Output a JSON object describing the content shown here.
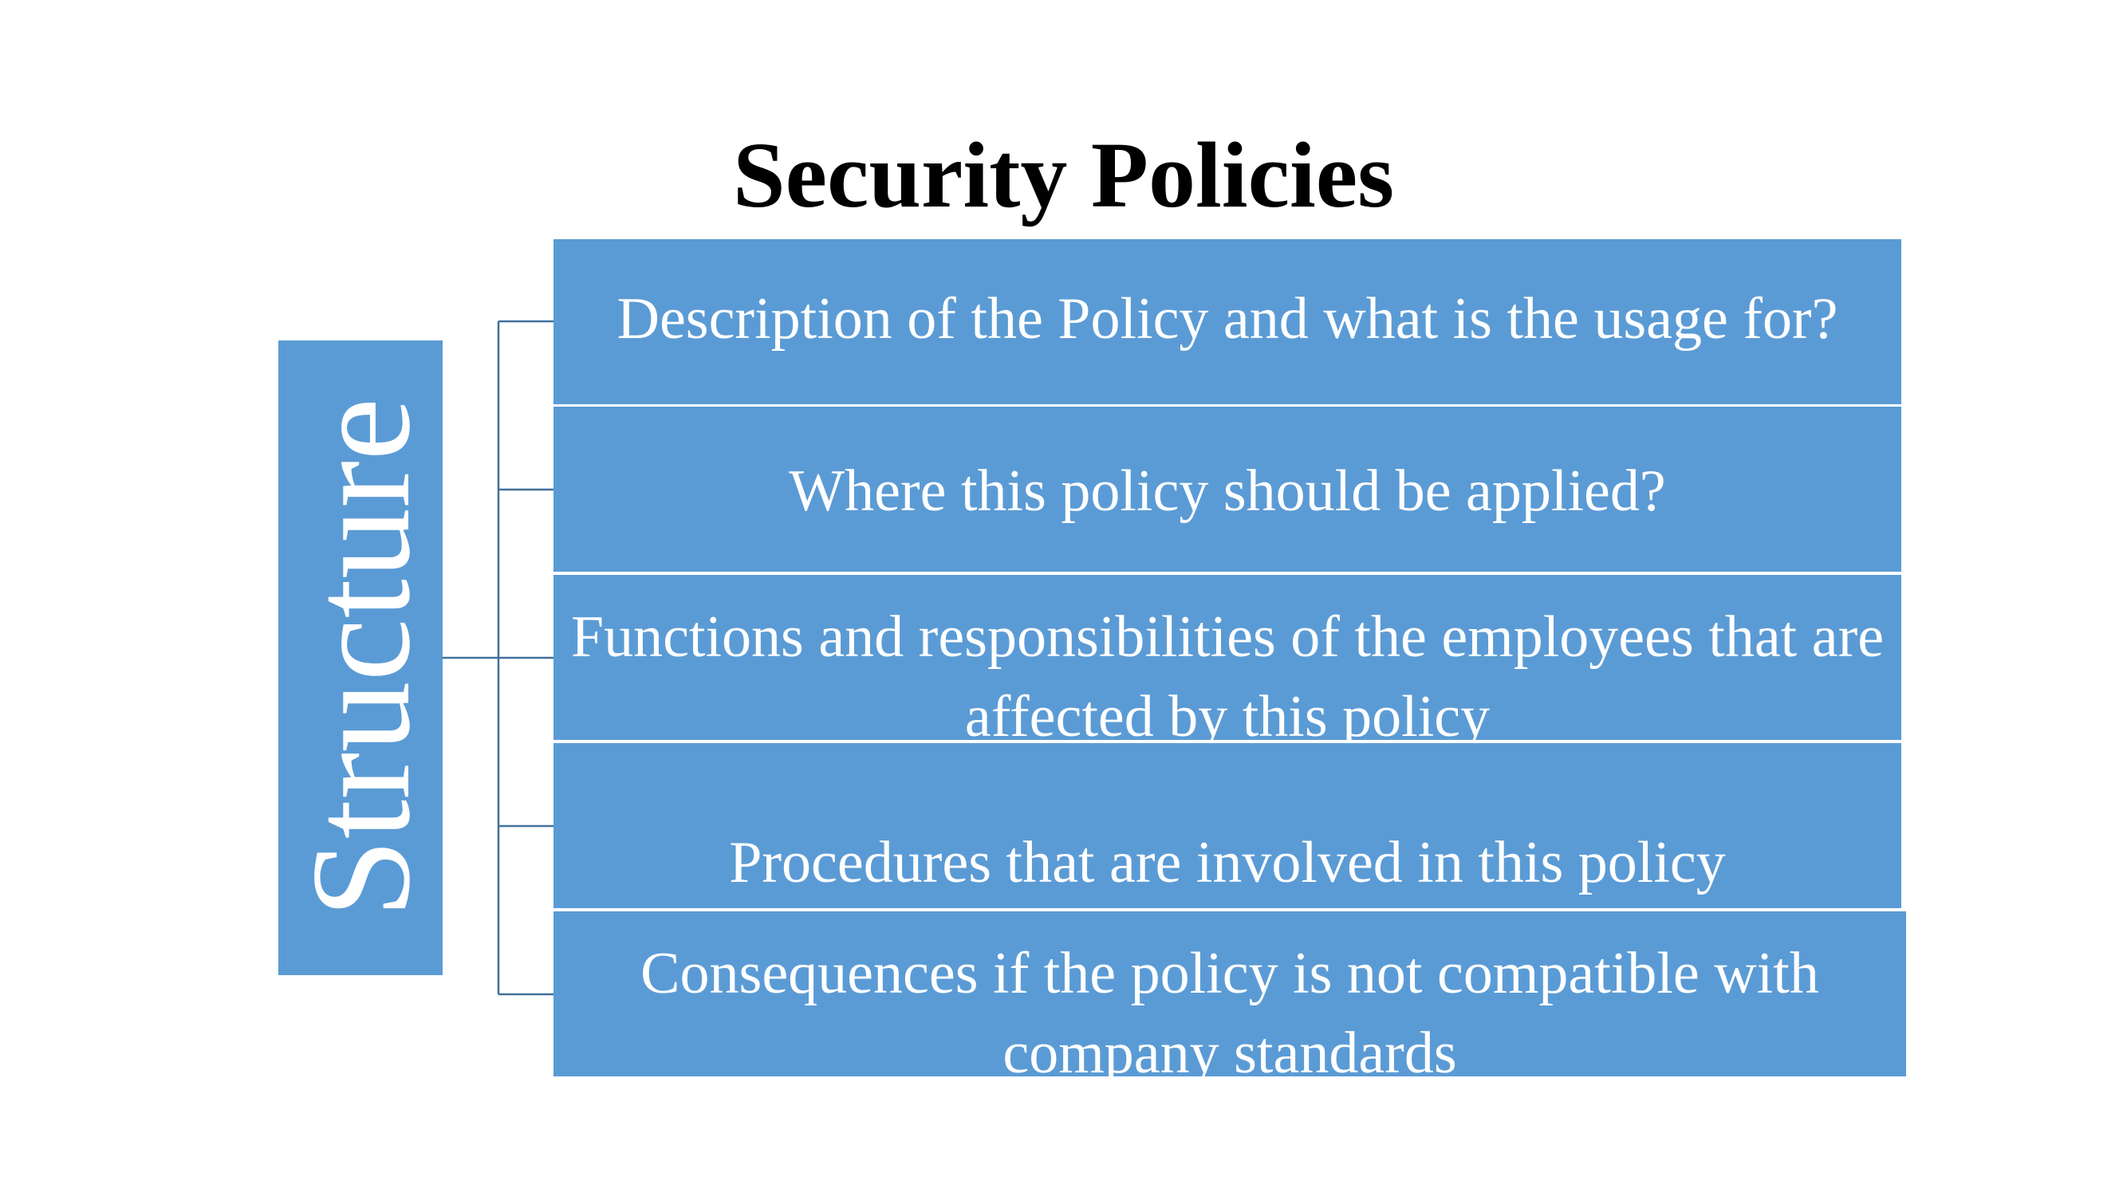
{
  "slide": {
    "title": "Security Policies"
  },
  "diagram": {
    "root_label": "Structure",
    "items": [
      {
        "text": "Description of the Policy and what is the usage for?"
      },
      {
        "text": "Where this policy should be applied?"
      },
      {
        "text": "Functions and responsibilities of the employees that  are affected by this policy"
      },
      {
        "text": "Procedures that are involved in this policy"
      },
      {
        "text": "Consequences if the policy is not compatible with  company standards"
      }
    ]
  },
  "colors": {
    "box_fill": "#5b9bd5",
    "box_text": "#ffffff",
    "connector": "#41719c",
    "title_text": "#000000",
    "background": "#ffffff"
  }
}
